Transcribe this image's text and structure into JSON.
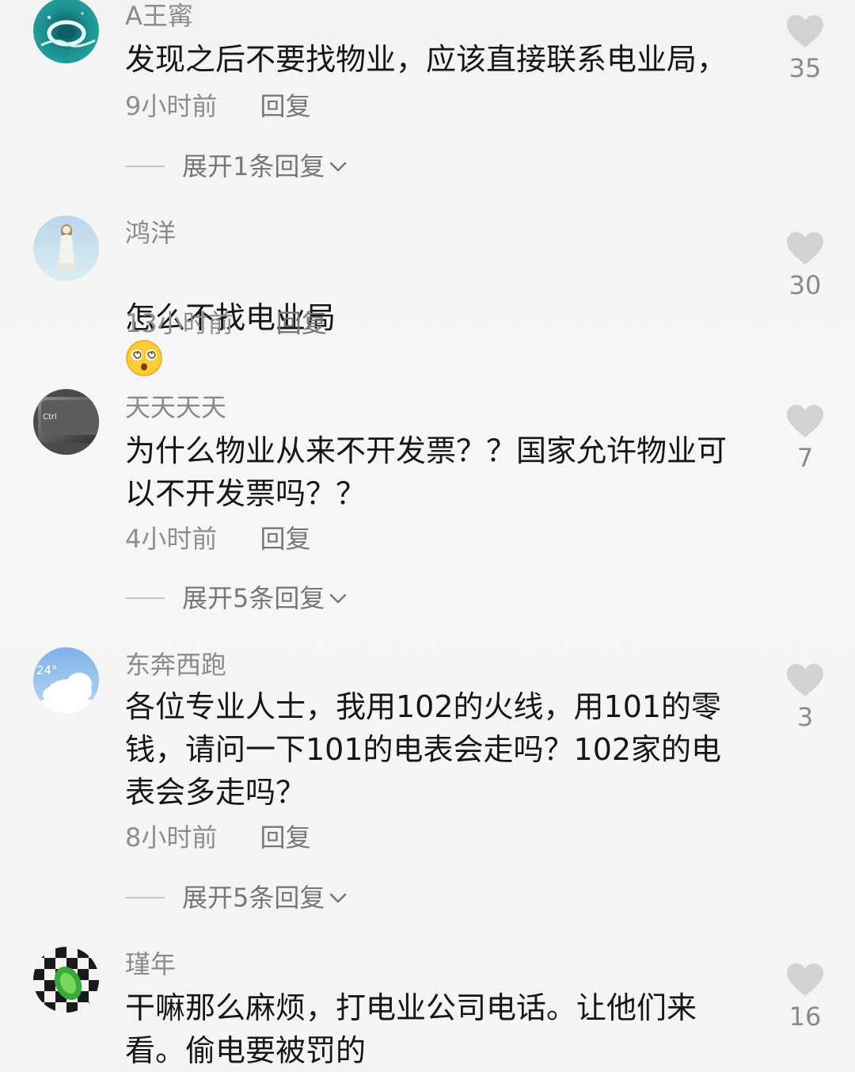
{
  "comments": [
    {
      "username": "A王寗",
      "text": "发现之后不要找物业，应该直接联系电业局，",
      "time": "9小时前",
      "reply_label": "回复",
      "likes": "35",
      "expand": "展开1条回复",
      "avatar": "ocean-swirl-avatar"
    },
    {
      "username": "鸿洋",
      "text": "怎么不找电业局",
      "emoji": "dizzy-face-emoji",
      "time": "13小时前",
      "reply_label": "回复",
      "likes": "30",
      "avatar": "statue-avatar"
    },
    {
      "username": "天天天天",
      "text": "为什么物业从来不开发票？？国家允许物业可\n以不开发票吗？？",
      "time": "4小时前",
      "reply_label": "回复",
      "likes": "7",
      "expand": "展开5条回复",
      "avatar": "ctrl-key-avatar",
      "avatar_text": "Ctrl"
    },
    {
      "username": "东奔西跑",
      "text": "各位专业人士，我用102的火线，用101的零\n钱，请问一下101的电表会走吗？102家的电\n表会多走吗？",
      "time": "8小时前",
      "reply_label": "回复",
      "likes": "3",
      "expand": "展开5条回复",
      "avatar": "weather-cloud-avatar",
      "avatar_text": "24°"
    },
    {
      "username": "瑾年",
      "text": "干嘛那么麻烦，打电业公司电话。让他们来\n看。偷电要被罚的",
      "likes": "16",
      "avatar": "checkered-flag-avatar"
    }
  ],
  "icons": {
    "like": "heart-icon",
    "expand": "chevron-down-icon"
  }
}
